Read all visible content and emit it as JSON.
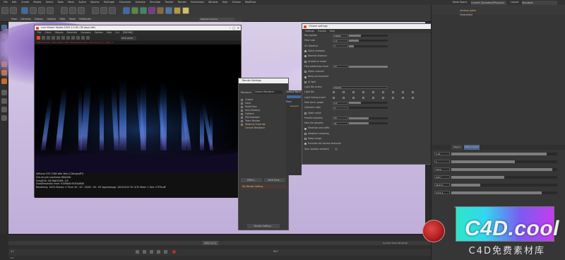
{
  "menubar": {
    "items": [
      "File",
      "Edit",
      "Create",
      "Modes",
      "Select",
      "Tools",
      "Mesh",
      "Spline",
      "Volume",
      "MoGraph",
      "Character",
      "Animate",
      "Simulate",
      "Tracker",
      "Render",
      "Extensions",
      "Window",
      "Help",
      "Octane",
      "RealFlow"
    ],
    "node_space_label": "Node Space",
    "node_space_value": "Current (Standard/Physical)",
    "layout_label": "Layout",
    "layout_value": "Standard"
  },
  "viewport_menu": [
    "View",
    "Cameras",
    "Display",
    "Options",
    "Filter",
    "Panel",
    "ProRender"
  ],
  "viewport_camera": "Default Camera",
  "live_viewer": {
    "title": "Live Viewer Studio 2020.1.5-R2 (30 days left)",
    "menu": [
      "File",
      "Cloud",
      "Objects",
      "Materials",
      "Compare",
      "Options",
      "Help",
      "Gui",
      "[ENGINE]"
    ],
    "toolbar_select": "HDR sRGB",
    "status_line": "Main-Render / Main-Pass / Main-Passes Denoiser / Remaining: 0 / Pass: 1",
    "info_lines": [
      "GeForce GTX 1080 with Max-Q Design(RT)",
      "Out-of-core used/max:0Kb/4Gb",
      "Grey8/16: 0/0        Rgb32/64: 1/0",
      "Used/free/total vram: 910Mb/6.953Gb/8Gb",
      "Rendering: 100%  Ms/sec: 0   Time: 00 : 00 : 00/00 : 00 : 00   Spp/maxspp: 1024/1024   Tri: 0/7k   Mesh: 1   Hair: 0   RTX:off"
    ]
  },
  "render_settings": {
    "title": "Render Settings",
    "renderer_label": "Renderer",
    "renderer_value": "Octane Renderer",
    "items": [
      "Output",
      "Save",
      "Multi-Pass",
      "Anti-Aliasing",
      "Options",
      "Stereoscopic",
      "Team Render",
      "Material Override",
      "Octane Renderer"
    ],
    "effect_button": "Effect...",
    "multipass_button": "Multi-Pass...",
    "my_setting": "My Render Setting",
    "footer_button": "Render Setting...",
    "side_header": "Octane Rend",
    "main_label": "Main",
    "general_label": "General"
  },
  "octane_settings": {
    "title": "Octane settings",
    "menu": [
      "Settings",
      "Presets",
      "Help"
    ],
    "rows": [
      {
        "type": "slider",
        "label": "Ray epsilon",
        "value": "0.0001",
        "fill": 0.3
      },
      {
        "type": "slider",
        "label": "Filter size",
        "value": "1.2",
        "fill": 0.25
      },
      {
        "type": "slider",
        "label": "AO distance",
        "value": "3",
        "fill": 0.12
      },
      {
        "type": "check",
        "label": "Alpha shadows",
        "checked": true
      },
      {
        "type": "check",
        "label": "Nearest distance",
        "checked": true
      },
      {
        "type": "check",
        "label": "Irradiance mode",
        "checked": false
      },
      {
        "type": "slider",
        "label": "Max subdivision level",
        "value": "10",
        "fill": 1.0
      },
      {
        "type": "check",
        "label": "Alpha channel",
        "checked": false
      },
      {
        "type": "check",
        "label": "Keep environment",
        "checked": true
      },
      {
        "type": "check",
        "label": "AI light",
        "checked": false
      },
      {
        "type": "select",
        "label": "Light IDs action",
        "value": "Disable"
      },
      {
        "type": "ids",
        "label": "Light IDs"
      },
      {
        "type": "ids",
        "label": "Light linking invert"
      },
      {
        "type": "slider",
        "label": "Path term. power",
        "value": "0.3",
        "fill": 0.3
      },
      {
        "type": "slider",
        "label": "Coherent ratio",
        "value": "0",
        "fill": 0.0
      },
      {
        "type": "check",
        "label": "Static noise",
        "checked": false
      },
      {
        "type": "slider",
        "label": "Parallel samples",
        "value": "16",
        "fill": 0.5
      },
      {
        "type": "slider",
        "label": "Max tile samples",
        "value": "32",
        "fill": 0.5
      },
      {
        "type": "check",
        "label": "Minimize net traffic",
        "checked": true
      },
      {
        "type": "check",
        "label": "Adaptive sampling",
        "checked": false
      },
      {
        "type": "check",
        "label": "Deep image",
        "checked": false
      },
      {
        "type": "check",
        "label": "Emulate old volume behavior",
        "checked": true
      },
      {
        "type": "text",
        "label": "Toon shadow ambient"
      }
    ]
  },
  "right_panel": {
    "object_name": "rainbow_lights",
    "object_item": "Octane(tm)",
    "tabs": [
      "Object",
      "Effect Control"
    ],
    "rows": [
      {
        "value": "1.21",
        "fill": 0.9
      },
      {
        "value": "1",
        "fill": 0.6
      },
      {
        "value": "1012",
        "fill": 0.95
      },
      {
        "value": "425 *",
        "fill": 0.5
      },
      {
        "value": "26.8 %",
        "fill": 0.27
      },
      {
        "value": "1712.1",
        "fill": 0.85
      }
    ],
    "gradient_label": "Gradient"
  },
  "timeline": {
    "frame_start": "0 F",
    "frame_end": "90 F",
    "pos_label": "POS: 0.0 0",
    "bottom_left": "0 F",
    "render_time": "Current Time: 00:00:00"
  },
  "watermark": {
    "main": "C4D.cool",
    "sub": "C4D免费素材库"
  }
}
